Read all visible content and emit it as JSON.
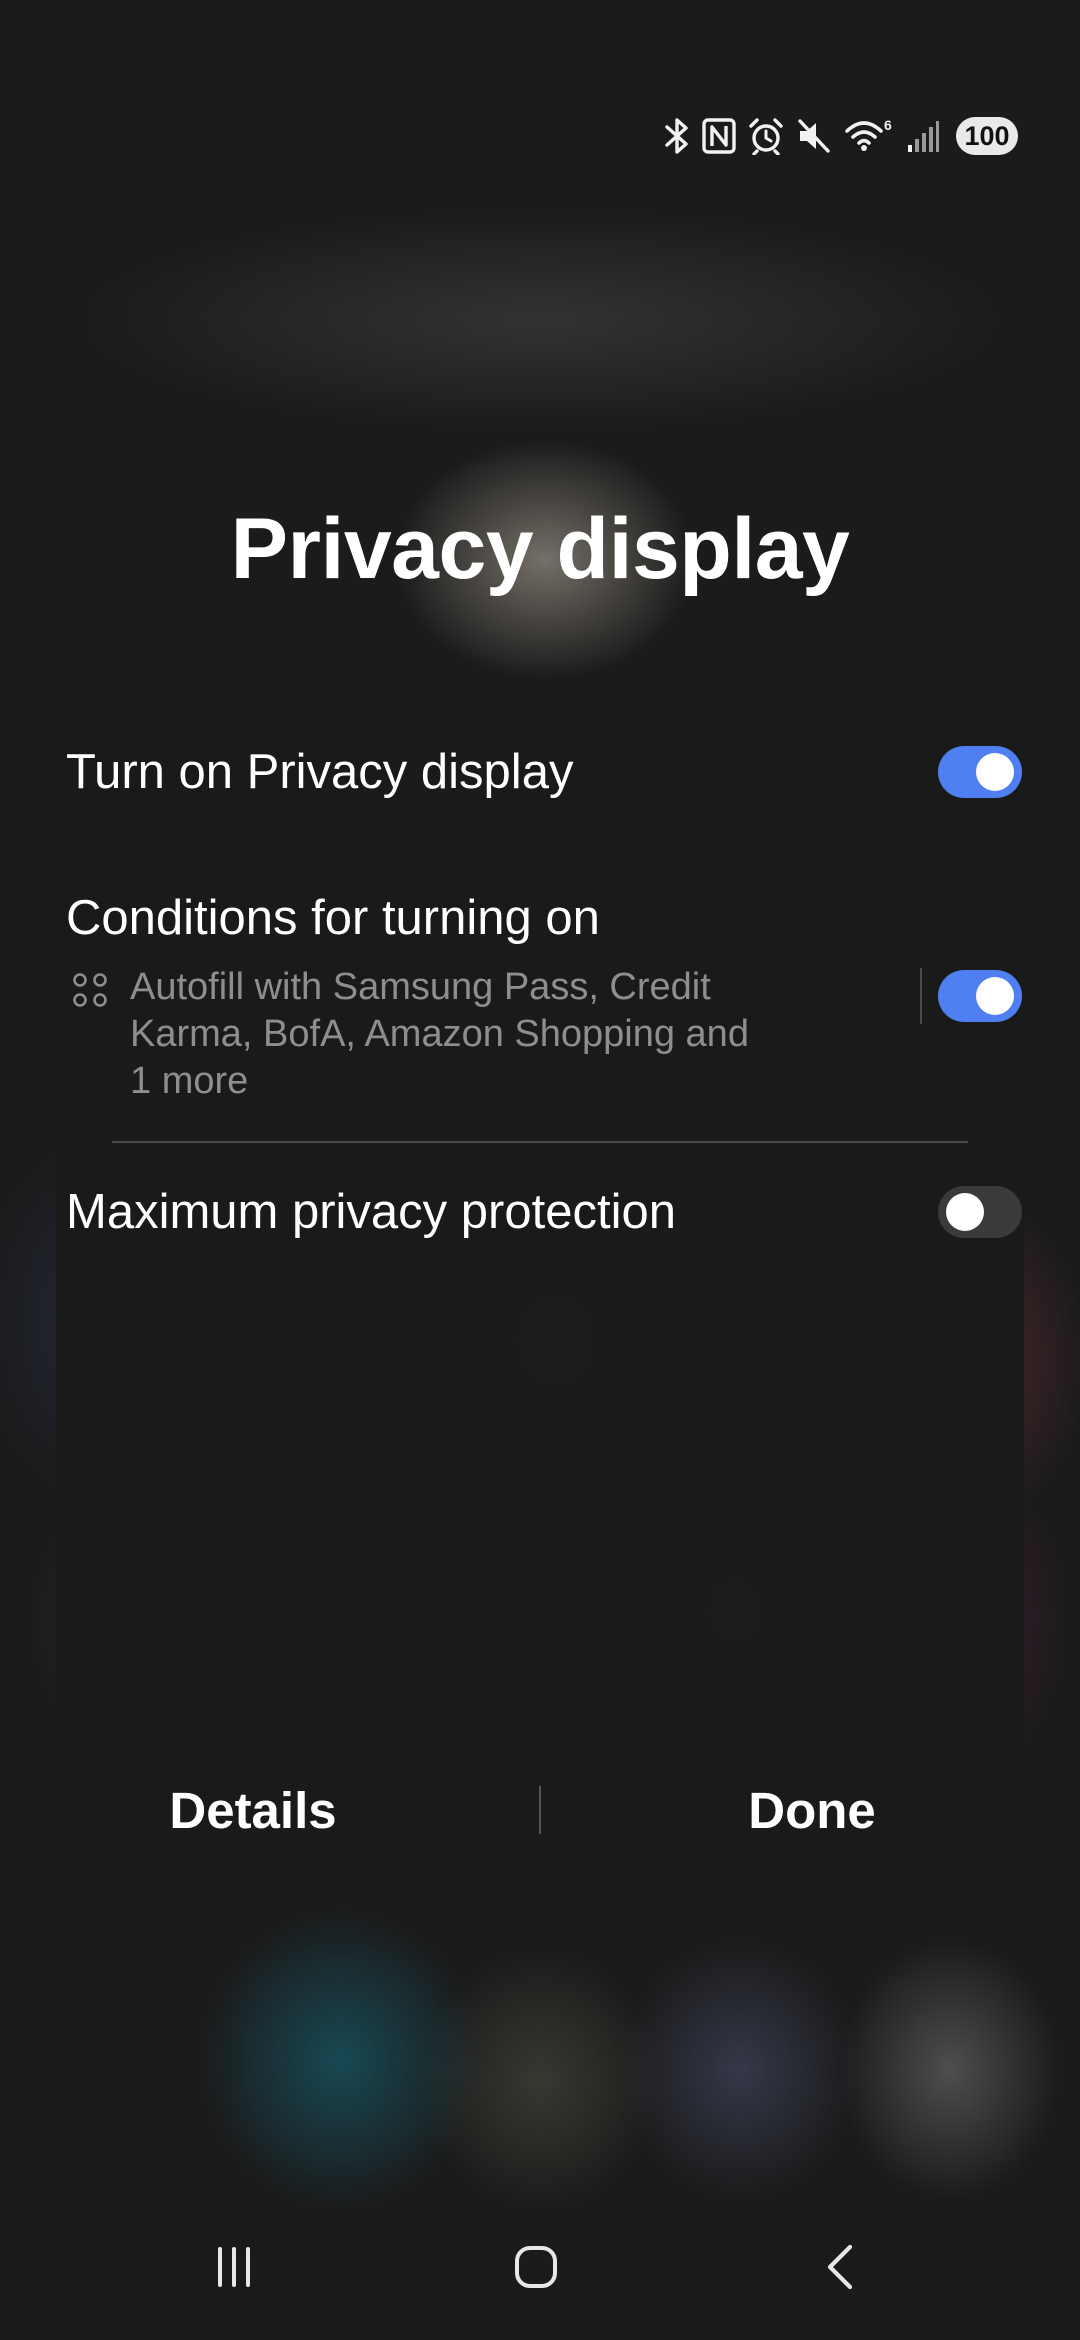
{
  "status_bar": {
    "icons": [
      "bluetooth-icon",
      "nfc-icon",
      "alarm-icon",
      "mute-icon",
      "wifi-6-icon",
      "signal-icon"
    ],
    "wifi_badge": "6",
    "battery_level": "100"
  },
  "title": "Privacy display",
  "settings": {
    "turn_on": {
      "label": "Turn on Privacy display",
      "enabled": true
    },
    "conditions": {
      "title": "Conditions for turning on",
      "description": "Autofill with Samsung Pass, Credit Karma, BofA, Amazon Shopping and 1 more",
      "enabled": true
    },
    "max_protection": {
      "label": "Maximum privacy protection",
      "enabled": false
    }
  },
  "actions": {
    "details_label": "Details",
    "done_label": "Done"
  },
  "colors": {
    "toggle_on": "#4f7ff0",
    "toggle_off": "#3a3a3a",
    "card_bg": "#1a1a1a",
    "secondary_text": "#8e8e8e"
  },
  "nav_bar": {
    "buttons": [
      "recents-icon",
      "home-icon",
      "back-icon"
    ]
  }
}
